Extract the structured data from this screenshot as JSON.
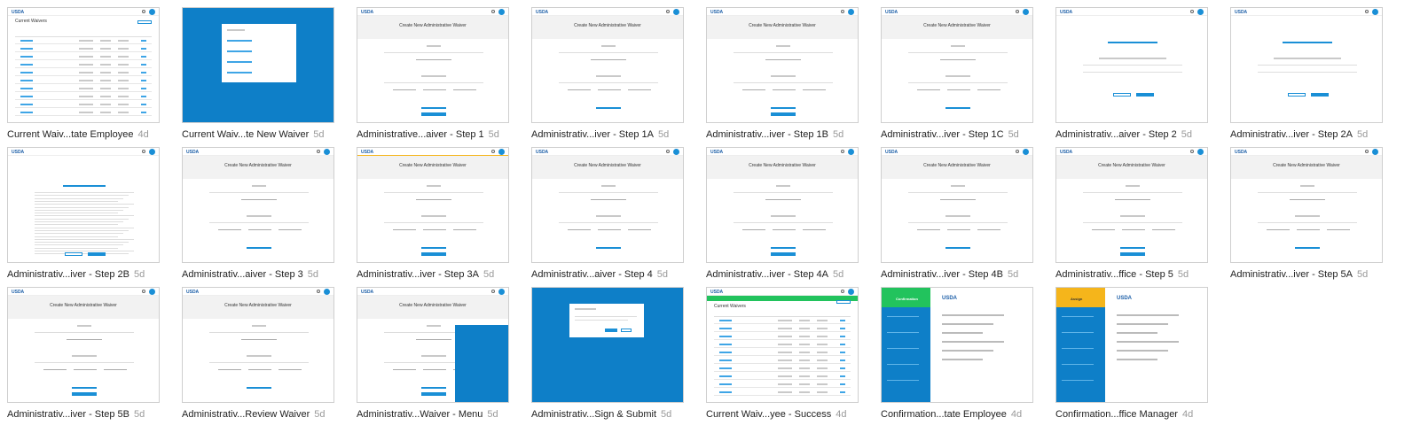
{
  "thumbnails": [
    {
      "caption": "Current Waiv...tate Employee",
      "age": "4d",
      "kind": "list",
      "page_title": "Current Waivers",
      "count": "(18)",
      "new_label": ""
    },
    {
      "caption": "Current Waiv...te New Waiver",
      "age": "5d",
      "kind": "modal-new"
    },
    {
      "caption": "Administrative...aiver - Step 1",
      "age": "5d",
      "kind": "form"
    },
    {
      "caption": "Administrativ...iver - Step 1A",
      "age": "5d",
      "kind": "form"
    },
    {
      "caption": "Administrativ...iver - Step 1B",
      "age": "5d",
      "kind": "form"
    },
    {
      "caption": "Administrativ...iver - Step 1C",
      "age": "5d",
      "kind": "form"
    },
    {
      "caption": "Administrativ...aiver - Step 2",
      "age": "5d",
      "kind": "form-short"
    },
    {
      "caption": "Administrativ...iver - Step 2A",
      "age": "5d",
      "kind": "form-short"
    },
    {
      "caption": "Administrativ...iver - Step 2B",
      "age": "5d",
      "kind": "text"
    },
    {
      "caption": "Administrativ...aiver - Step 3",
      "age": "5d",
      "kind": "form"
    },
    {
      "caption": "Administrativ...iver - Step 3A",
      "age": "5d",
      "kind": "form-yellow"
    },
    {
      "caption": "Administrativ...aiver - Step 4",
      "age": "5d",
      "kind": "form"
    },
    {
      "caption": "Administrativ...iver - Step 4A",
      "age": "5d",
      "kind": "form"
    },
    {
      "caption": "Administrativ...iver - Step 4B",
      "age": "5d",
      "kind": "form"
    },
    {
      "caption": "Administrativ...ffice - Step 5",
      "age": "5d",
      "kind": "form"
    },
    {
      "caption": "Administrativ...iver - Step 5A",
      "age": "5d",
      "kind": "form"
    },
    {
      "caption": "Administrativ...iver - Step 5B",
      "age": "5d",
      "kind": "form"
    },
    {
      "caption": "Administrativ...Review Waiver",
      "age": "5d",
      "kind": "review"
    },
    {
      "caption": "Administrativ...Waiver - Menu",
      "age": "5d",
      "kind": "menu"
    },
    {
      "caption": "Administrativ...Sign & Submit",
      "age": "5d",
      "kind": "modal-sign"
    },
    {
      "caption": "Current Waiv...yee - Success",
      "age": "4d",
      "kind": "list-success"
    },
    {
      "caption": "Confirmation...tate Employee",
      "age": "4d",
      "kind": "confirm-green"
    },
    {
      "caption": "Confirmation...ffice Manager",
      "age": "4d",
      "kind": "confirm-yellow"
    }
  ],
  "thumb_text": {
    "create_title": "Create New Administrative Waiver",
    "usda": "USDA",
    "confirm_head": "Confirmation",
    "assign_head": "Assign"
  },
  "colors": {
    "accent": "#1a8fd6",
    "deep_blue": "#0e7fc8",
    "success": "#22c35d",
    "warning": "#f5b51b"
  }
}
